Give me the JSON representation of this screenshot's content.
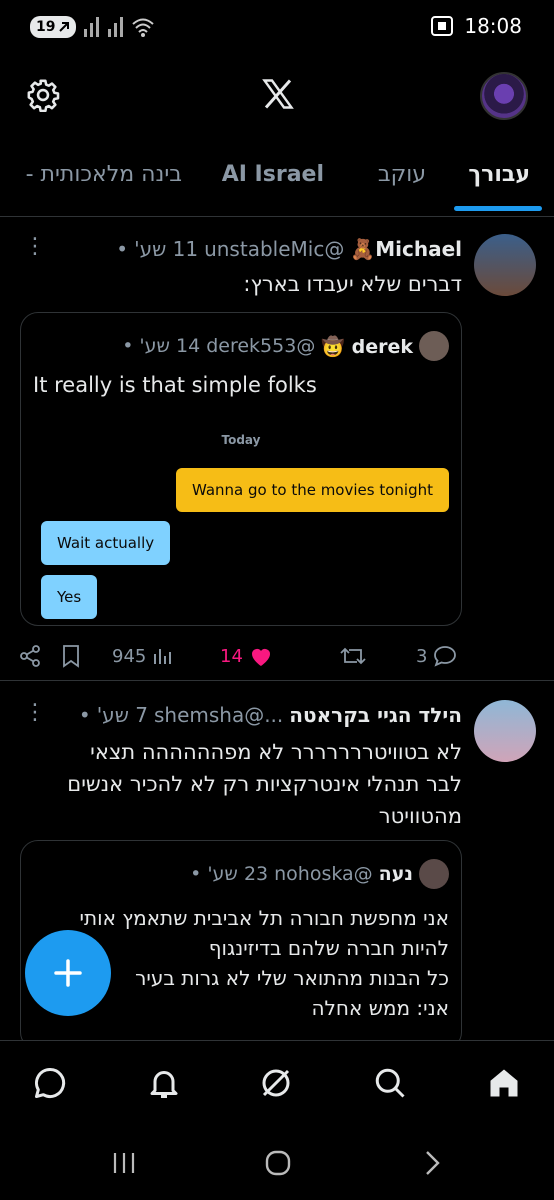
{
  "status_bar": {
    "notification_count": "19",
    "time": "18:08"
  },
  "tabs": [
    {
      "label": "עבורך"
    },
    {
      "label": "עוקב"
    },
    {
      "label": "AI Israel"
    },
    {
      "label": "בינה מלאכותית -"
    }
  ],
  "tweets": [
    {
      "name": "Michael🧸",
      "handle": "@unstableMic",
      "time": "11 שע'",
      "text": "דברים שלא יעבדו בארץ:",
      "quote": {
        "name": "derek 🤠",
        "handle": "@derek553",
        "time": "14 שע'",
        "text": "It really is that simple folks",
        "chat": {
          "day_label": "Today",
          "messages": [
            {
              "text": "Wanna go to the movies tonight",
              "side": "right",
              "color": "yellow"
            },
            {
              "text": "Wait actually",
              "side": "left",
              "color": "blue"
            },
            {
              "text": "Yes",
              "side": "left",
              "color": "blue"
            }
          ]
        }
      },
      "stats": {
        "views": "945",
        "likes": "14",
        "retweets": "",
        "replies": "3"
      }
    },
    {
      "name": "הילד הגיי בקראטה",
      "handle": "...@shemsha",
      "time": "7 שע'",
      "text": "לא בטוויטררררררר לא מפהההההה תצאי\nלבר תנהלי אינטרקציות רק לא להכיר אנשים\nמהטוויטר",
      "quote": {
        "name": "נעה",
        "handle": "@nohoska",
        "time": "23 שע'",
        "text": "אני מחפשת חבורה תל אביבית שתאמץ אותי\nלהיות חברה שלהם בדיזינגוף\nכל הבנות מהתואר שלי לא גרות בעיר\nאני: ממש אחלה"
      }
    }
  ],
  "colors": {
    "accent": "#1d9bf0",
    "like": "#f91880",
    "bubble_yellow": "#f6bd16",
    "bubble_blue": "#7fd1ff"
  }
}
